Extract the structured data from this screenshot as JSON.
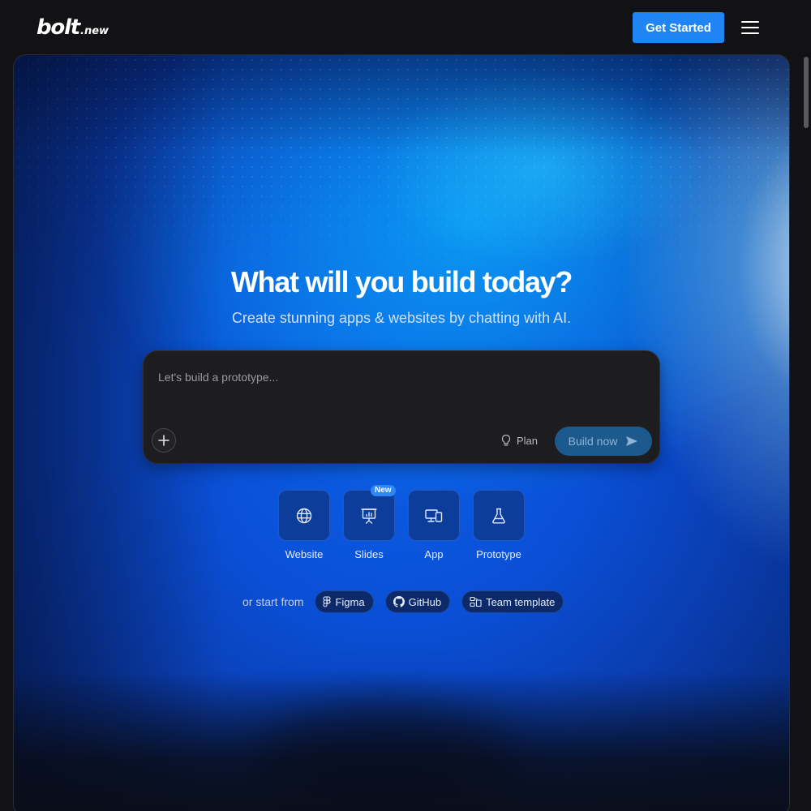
{
  "header": {
    "logo_main": "bolt",
    "logo_sub": ".new",
    "cta_label": "Get Started",
    "menu_icon": "hamburger-menu-icon"
  },
  "hero": {
    "title": "What will you build today?",
    "subtitle": "Create stunning apps & websites by chatting with AI."
  },
  "prompt": {
    "placeholder": "Let's build a prototype...",
    "plan_label": "Plan",
    "build_label": "Build now",
    "add_icon": "plus-icon",
    "plan_icon": "lightbulb-icon",
    "send_icon": "send-icon"
  },
  "categories": [
    {
      "label": "Website",
      "icon": "globe-icon"
    },
    {
      "label": "Slides",
      "icon": "presentation-icon",
      "badge": "New"
    },
    {
      "label": "App",
      "icon": "devices-icon"
    },
    {
      "label": "Prototype",
      "icon": "flask-icon"
    }
  ],
  "start_from": {
    "label": "or start from",
    "options": [
      {
        "label": "Figma",
        "icon": "figma-icon"
      },
      {
        "label": "GitHub",
        "icon": "github-icon"
      },
      {
        "label": "Team template",
        "icon": "template-icon"
      }
    ]
  },
  "colors": {
    "accent": "#1f85f5",
    "page_background": "#121214",
    "prompt_background": "#1d1d20",
    "build_button": "#1c5a8e",
    "tile": "#0d3d9b"
  }
}
